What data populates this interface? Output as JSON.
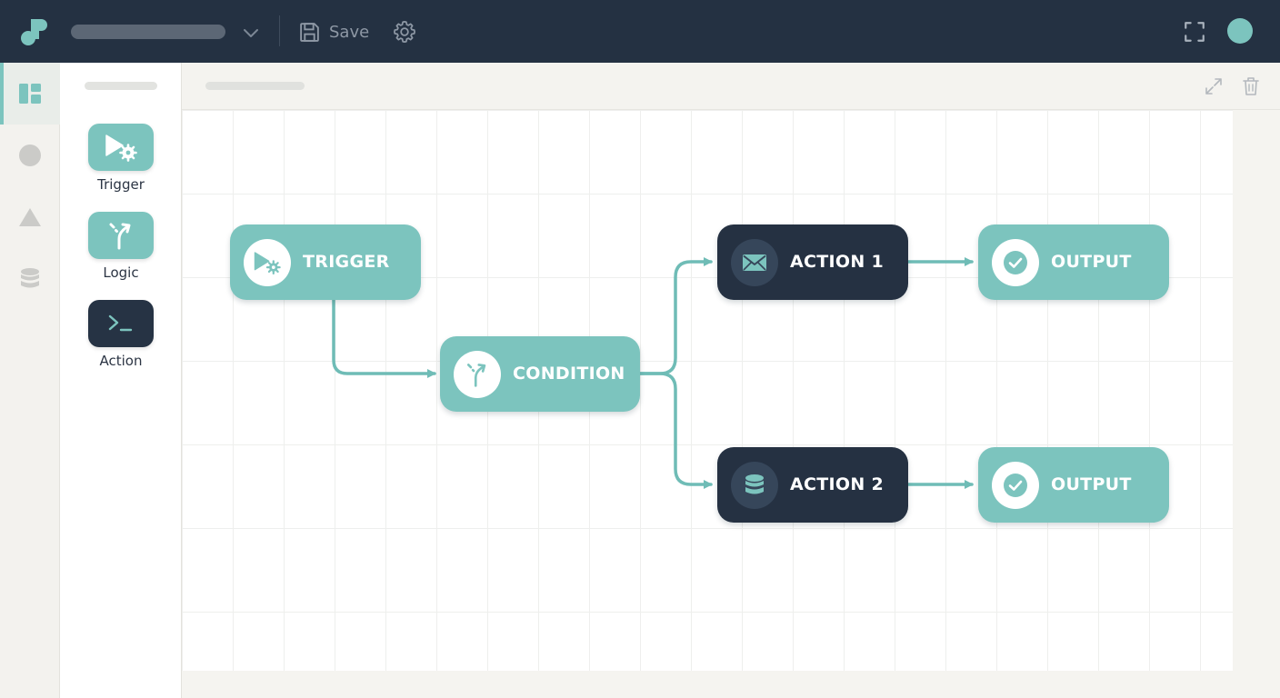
{
  "toolbar": {
    "save_label": "Save"
  },
  "rail": {
    "items": [
      {
        "icon": "dashboard-icon",
        "active": true
      },
      {
        "icon": "circle-icon",
        "active": false
      },
      {
        "icon": "triangle-icon",
        "active": false
      },
      {
        "icon": "database-icon",
        "active": false
      }
    ]
  },
  "palette": {
    "tools": [
      {
        "label": "Trigger",
        "icon": "play-gear-icon"
      },
      {
        "label": "Logic",
        "icon": "branch-icon"
      },
      {
        "label": "Action",
        "icon": "terminal-icon"
      }
    ]
  },
  "flow": {
    "nodes": [
      {
        "id": "trigger",
        "label": "TRIGGER",
        "icon": "play-gear-icon"
      },
      {
        "id": "condition",
        "label": "CONDITION",
        "icon": "branch-icon"
      },
      {
        "id": "action1",
        "label": "ACTION 1",
        "icon": "mail-icon"
      },
      {
        "id": "action2",
        "label": "ACTION 2",
        "icon": "database-icon"
      },
      {
        "id": "output1",
        "label": "OUTPUT",
        "icon": "check-circle-icon"
      },
      {
        "id": "output2",
        "label": "OUTPUT",
        "icon": "check-circle-icon"
      }
    ],
    "edges": [
      {
        "from": "trigger",
        "to": "condition"
      },
      {
        "from": "condition",
        "to": "action1"
      },
      {
        "from": "condition",
        "to": "action2"
      },
      {
        "from": "action1",
        "to": "output1"
      },
      {
        "from": "action2",
        "to": "output2"
      }
    ]
  },
  "colors": {
    "topbar": "#243142",
    "accent": "#7cc4be",
    "dark_node": "#253142",
    "canvas": "#ffffff"
  }
}
